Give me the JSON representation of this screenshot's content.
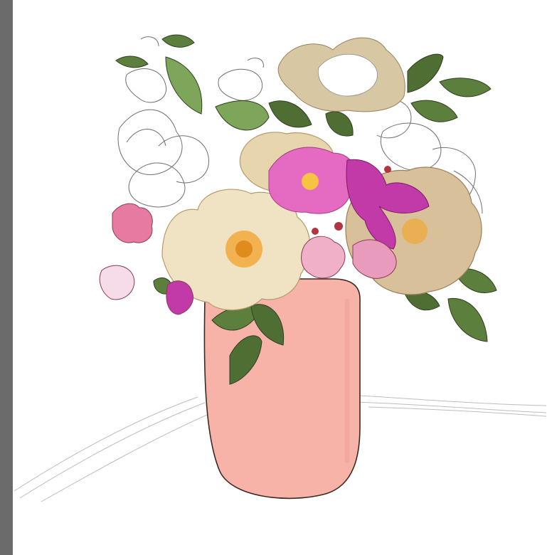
{
  "app": {
    "left_gutter_color": "#6b6b6b",
    "canvas_background": "#ffffff"
  },
  "artwork": {
    "subject": "illustration-vase-with-flowers",
    "palette": {
      "vase": "#f7b3a8",
      "vase_outline": "#3a2a22",
      "leaf": "#6a8f45",
      "leaf_dark": "#4f6e33",
      "leaf_vein": "#2f3f1f",
      "rose_cream": "#efe3c4",
      "rose_tan": "#cdb58f",
      "rose_center": "#f2a93b",
      "cosmos_pink": "#e46ac2",
      "magenta": "#c23aa8",
      "pink": "#e67aa0",
      "sketch_line": "#6f6f6f",
      "table_sketch": "#bdbdbd"
    }
  }
}
